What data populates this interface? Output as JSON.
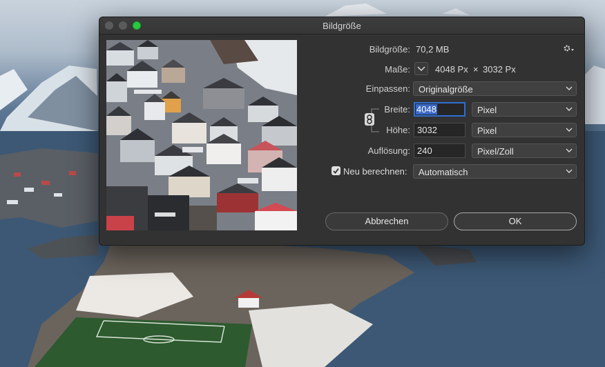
{
  "window": {
    "title": "Bildgröße"
  },
  "image_size": {
    "label": "Bildgröße:",
    "value": "70,2 MB"
  },
  "dimensions": {
    "label": "Maße:",
    "width": "4048 Px",
    "times": "×",
    "height": "3032 Px"
  },
  "fit": {
    "label": "Einpassen:",
    "value": "Originalgröße"
  },
  "width": {
    "label": "Breite:",
    "value": "4048",
    "unit": "Pixel"
  },
  "height": {
    "label": "Höhe:",
    "value": "3032",
    "unit": "Pixel"
  },
  "resolution": {
    "label": "Auflösung:",
    "value": "240",
    "unit": "Pixel/Zoll"
  },
  "resample": {
    "label": "Neu berechnen:",
    "checked": true,
    "value": "Automatisch"
  },
  "buttons": {
    "cancel": "Abbrechen",
    "ok": "OK"
  },
  "icons": {
    "gear": "gear-icon",
    "link": "link-chain-icon",
    "chevron": "chevron-down-icon",
    "check": "checkmark-icon"
  },
  "colors": {
    "accent": "#2f6fd6",
    "zoom_button": "#27c93f",
    "dialog_bg": "#323232"
  }
}
